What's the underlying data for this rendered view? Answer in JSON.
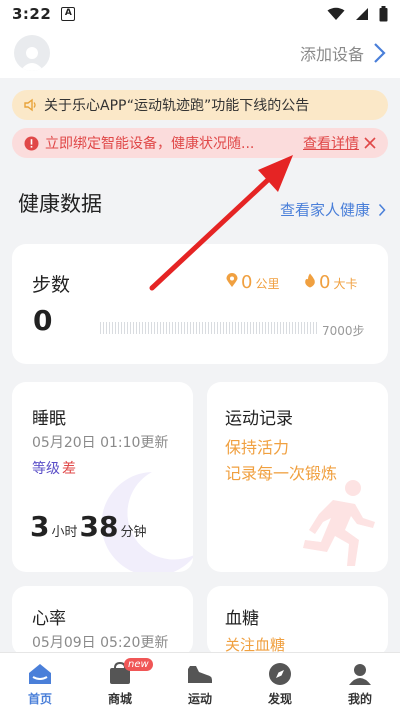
{
  "status_bar": {
    "time": "3:22",
    "notification_badge": "A"
  },
  "header": {
    "add_device": "添加设备"
  },
  "notice": {
    "text": "关于乐心APP“运动轨迹跑”功能下线的公告"
  },
  "alert": {
    "text": "立即绑定智能设备，健康状况随...",
    "detail": "查看详情"
  },
  "section": {
    "title": "健康数据",
    "link": "查看家人健康"
  },
  "steps": {
    "title": "步数",
    "value": "0",
    "distance_value": "0",
    "distance_unit": "公里",
    "calorie_value": "0",
    "calorie_unit": "大卡",
    "goal": "7000步",
    "progress": 0
  },
  "sleep": {
    "title": "睡眠",
    "updated": "05月20日 01:10更新",
    "level_label": "等级",
    "level_value": "差",
    "hours": "3",
    "hours_unit": "小时",
    "minutes": "38",
    "minutes_unit": "分钟"
  },
  "exercise": {
    "title": "运动记录",
    "line1": "保持活力",
    "line2": "记录每一次锻炼"
  },
  "heart": {
    "title": "心率",
    "updated": "05月09日 05:20更新"
  },
  "sugar": {
    "title": "血糖",
    "subtitle": "关注血糖"
  },
  "tabs": [
    {
      "label": "首页",
      "icon": "home-icon",
      "active": true
    },
    {
      "label": "商城",
      "icon": "shop-icon",
      "badge": "new"
    },
    {
      "label": "运动",
      "icon": "shoe-icon"
    },
    {
      "label": "发现",
      "icon": "compass-icon"
    },
    {
      "label": "我的",
      "icon": "profile-icon"
    }
  ],
  "colors": {
    "accent": "#4a7fd9",
    "orange": "#f0a040",
    "alert_red": "#e04848",
    "arrow": "#e52424"
  }
}
